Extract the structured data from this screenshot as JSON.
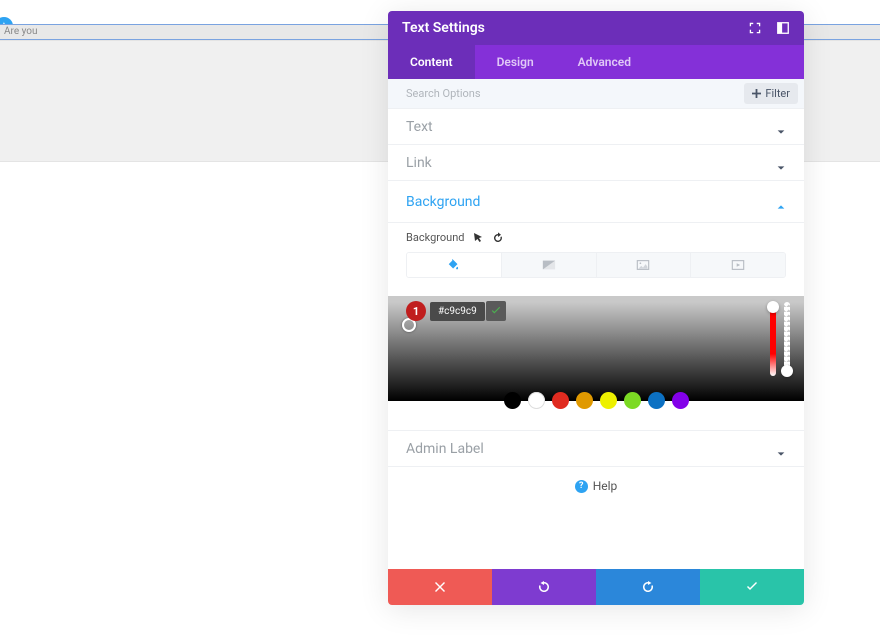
{
  "page": {
    "behind_text": "Are you"
  },
  "modal": {
    "title": "Text Settings",
    "tabs": {
      "content": "Content",
      "design": "Design",
      "advanced": "Advanced",
      "active": "content"
    },
    "search": {
      "placeholder": "Search Options",
      "filter_label": "Filter"
    },
    "sections": {
      "text": "Text",
      "link": "Link",
      "background": "Background",
      "admin_label": "Admin Label"
    },
    "background": {
      "label": "Background",
      "hex_value": "#c9c9c9",
      "step_badge": "1",
      "swatches": [
        "#000000",
        "#ffffff",
        "#e02b20",
        "#e09900",
        "#edf000",
        "#7cda24",
        "#0c71c3",
        "#8300e9"
      ]
    },
    "help": "Help"
  }
}
